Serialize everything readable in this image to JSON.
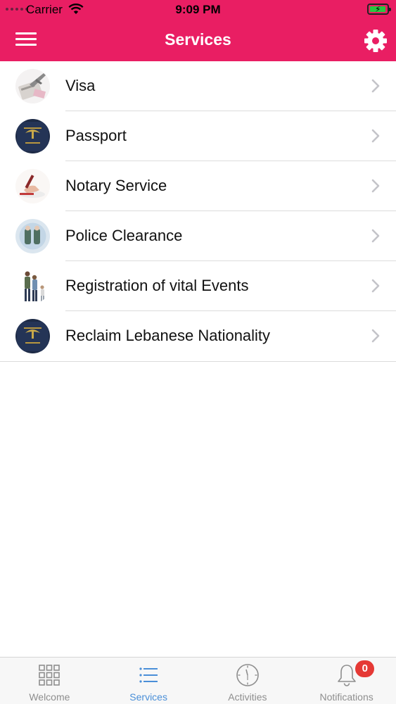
{
  "status_bar": {
    "carrier": "Carrier",
    "time": "9:09 PM"
  },
  "header": {
    "title": "Services",
    "menu_icon": "hamburger-menu-icon",
    "settings_icon": "gear-icon",
    "background_color": "#e91e63"
  },
  "services": [
    {
      "label": "Visa",
      "icon": "visa-thumbnail"
    },
    {
      "label": "Passport",
      "icon": "passport-thumbnail"
    },
    {
      "label": "Notary Service",
      "icon": "notary-thumbnail"
    },
    {
      "label": "Police Clearance",
      "icon": "police-clearance-thumbnail"
    },
    {
      "label": "Registration of vital Events",
      "icon": "family-thumbnail"
    },
    {
      "label": "Reclaim Lebanese Nationality",
      "icon": "passport-thumbnail"
    }
  ],
  "tabbar": {
    "active_color": "#4a8fd8",
    "tabs": [
      {
        "label": "Welcome",
        "icon": "grid-icon"
      },
      {
        "label": "Services",
        "icon": "list-icon",
        "active": true
      },
      {
        "label": "Activities",
        "icon": "clock-icon"
      },
      {
        "label": "Notifications",
        "icon": "bell-icon",
        "badge": "0"
      }
    ]
  }
}
